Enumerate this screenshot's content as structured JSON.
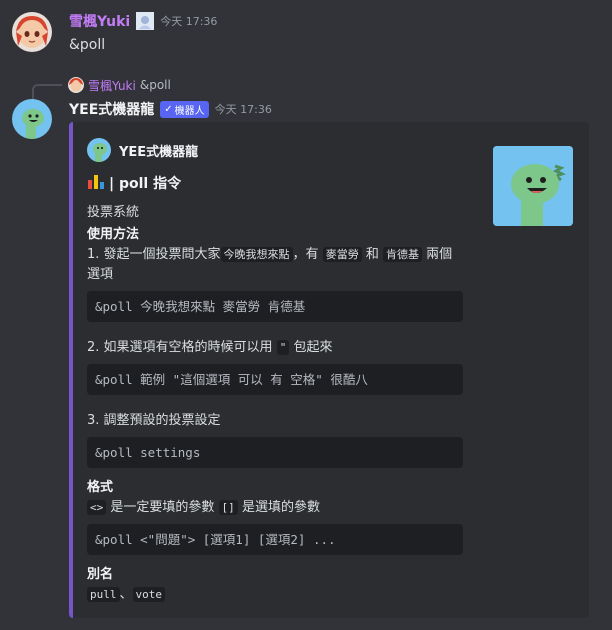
{
  "message1": {
    "username": "雪楓Yuki",
    "timestamp": "今天 17:36",
    "content": "&poll"
  },
  "reply": {
    "username": "雪楓Yuki",
    "content": "&poll"
  },
  "message2": {
    "botname": "YEE式機器龍",
    "bot_badge": "機器人",
    "timestamp": "今天 17:36"
  },
  "embed": {
    "author": "YEE式機器龍",
    "title": "| poll 指令",
    "description": "投票系統",
    "usage_heading": "使用方法",
    "step1_prefix": "1. 發起一個投票問大家",
    "step1_code1": "今晚我想來點",
    "step1_sep1": "，有",
    "step1_code2": "麥當勞",
    "step1_sep2": "和",
    "step1_code3": "肯德基",
    "step1_suffix": "兩個選項",
    "block1": "&poll 今晚我想來點 麥當勞 肯德基",
    "step2_prefix": "2. 如果選項有空格的時候可以用",
    "step2_code": "\"",
    "step2_suffix": "包起來",
    "block2": "&poll 範例 \"這個選項 可以 有 空格\" 很酷八",
    "step3": "3. 調整預設的投票設定",
    "block3": "&poll settings",
    "format_heading": "格式",
    "format_code1": "<>",
    "format_text1": "是一定要填的參數",
    "format_code2": "[]",
    "format_text2": "是選填的參數",
    "block4": "&poll <\"問題\"> [選項1] [選項2] ...",
    "alias_heading": "別名",
    "alias1": "pull",
    "alias_sep": "、",
    "alias2": "vote"
  }
}
